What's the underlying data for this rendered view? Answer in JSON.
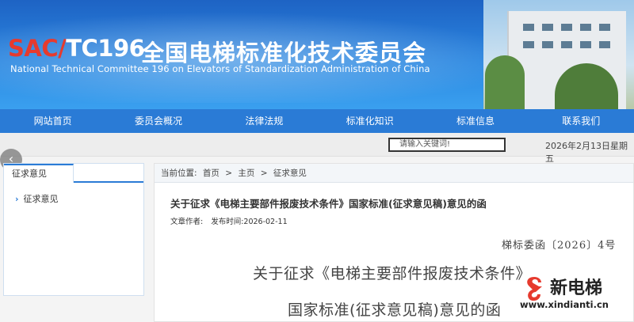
{
  "header": {
    "code_prefix": "SAC/",
    "code_suffix": "TC196",
    "title_cn": "全国电梯标准化技术委员会",
    "title_en": "National Technical Committee 196 on Elevators of Standardization Administration of China"
  },
  "nav": {
    "items": [
      {
        "label": "网站首页"
      },
      {
        "label": "委员会概况"
      },
      {
        "label": "法律法规"
      },
      {
        "label": "标准化知识"
      },
      {
        "label": "标准信息"
      },
      {
        "label": "联系我们"
      }
    ]
  },
  "search": {
    "placeholder": "请输入关键词!",
    "date": "2026年2月13日星期五"
  },
  "sidebar": {
    "tab": "征求意见",
    "items": [
      {
        "label": "征求意见"
      }
    ]
  },
  "breadcrumb": {
    "prefix": "当前位置:",
    "items": [
      "首页",
      ">",
      "主页",
      ">",
      "征求意见"
    ]
  },
  "article": {
    "title": "关于征求《电梯主要部件报废技术条件》国家标准(征求意见稿)意见的函",
    "author_label": "文章作者:",
    "date_label": "发布时间:",
    "date": "2026-02-11",
    "doc_number": "梯标委函〔2026〕4号",
    "body_line1": "关于征求《电梯主要部件报废技术条件》",
    "body_line2": "国家标准(征求意见稿)意见的函"
  },
  "watermark": {
    "name": "新电梯",
    "url": "www.xindianti.cn"
  },
  "colors": {
    "accent": "#2a7bd6",
    "banner": "#1e63c4",
    "code_red": "#e63a2e"
  },
  "icons": {
    "back": "chevron-left-icon",
    "side_arrow": "chevron-right-icon"
  }
}
